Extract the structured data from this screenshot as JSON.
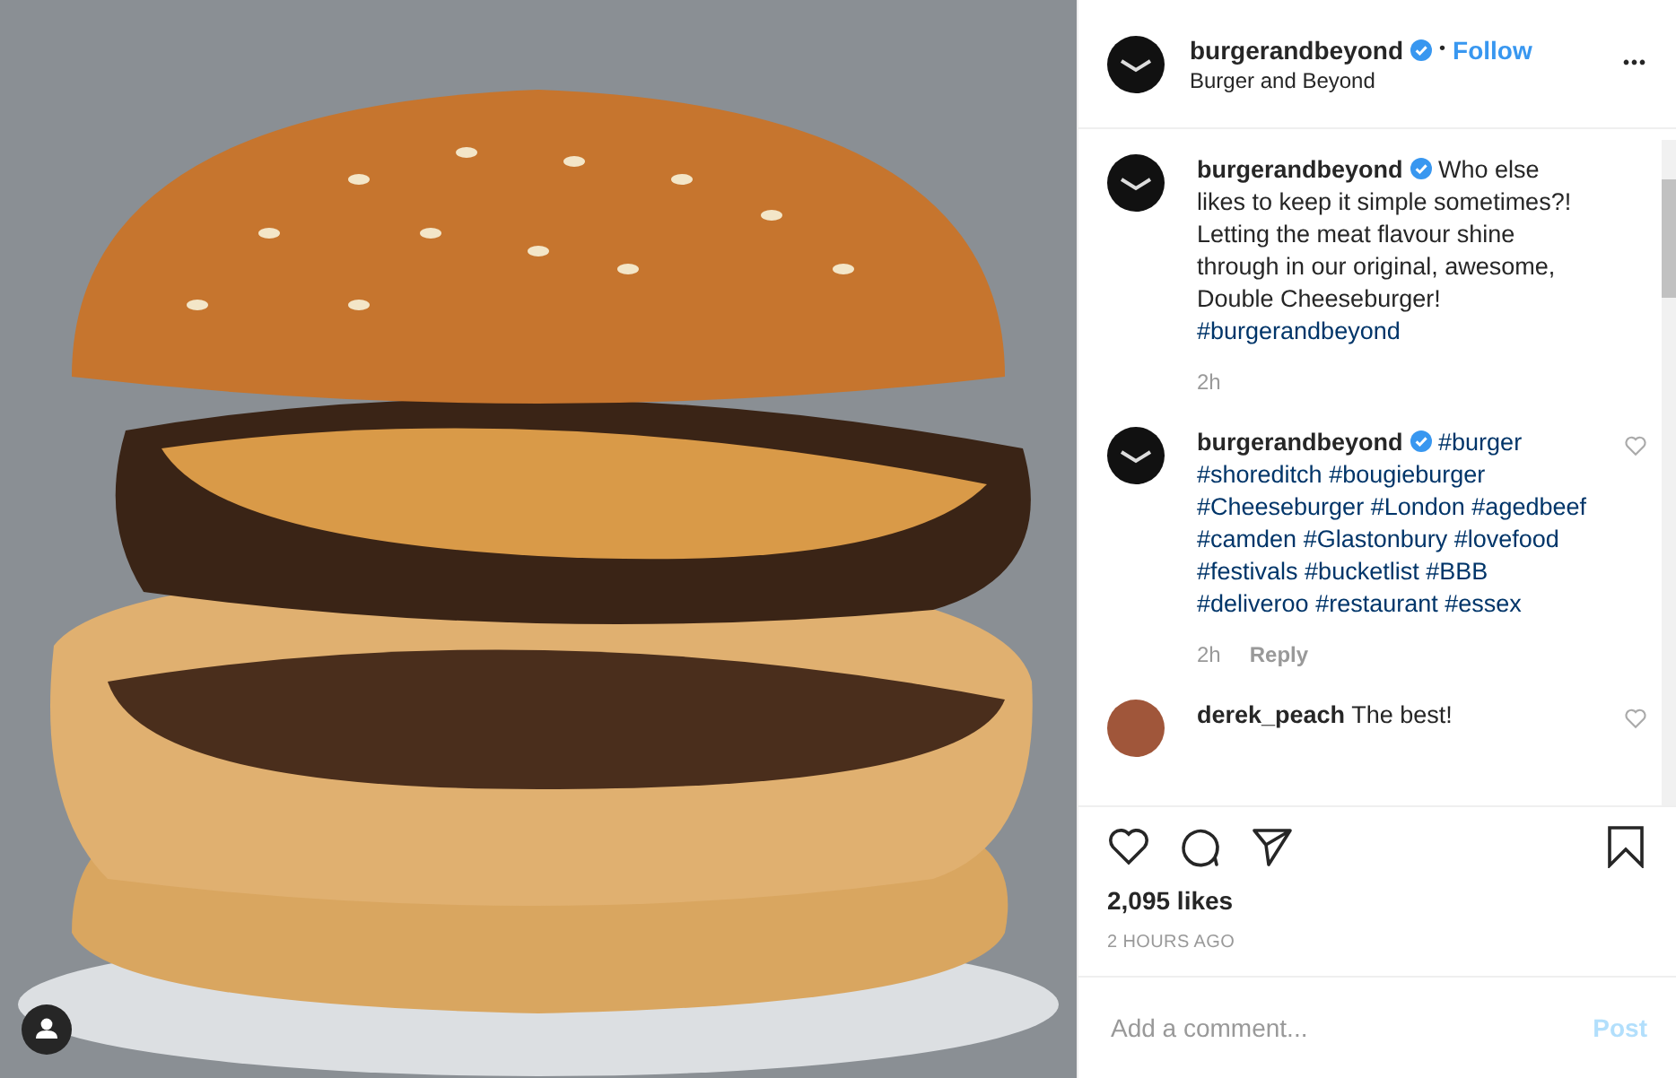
{
  "header": {
    "username": "burgerandbeyond",
    "verified": true,
    "follow": "Follow",
    "separator": "•",
    "subtitle": "Burger and Beyond",
    "menu": "•••"
  },
  "comments": [
    {
      "kind": "caption",
      "username": "burgerandbeyond",
      "verified": true,
      "parts": [
        {
          "kind": "text",
          "text": "Who else likes to keep it simple sometimes?! Letting the meat flavour shine through in our original, awesome, Double Cheeseburger!"
        },
        {
          "kind": "break"
        },
        {
          "kind": "tag",
          "text": "#burgerandbeyond"
        }
      ],
      "time": "2h"
    },
    {
      "kind": "reply",
      "username": "burgerandbeyond",
      "verified": true,
      "parts": [
        {
          "kind": "tag",
          "text": "#burger"
        },
        {
          "kind": "tag",
          "text": "#shoreditch"
        },
        {
          "kind": "tag",
          "text": "#bougieburger"
        },
        {
          "kind": "tag",
          "text": "#Cheeseburger"
        },
        {
          "kind": "tag",
          "text": "#London"
        },
        {
          "kind": "tag",
          "text": "#agedbeef"
        },
        {
          "kind": "tag",
          "text": "#camden"
        },
        {
          "kind": "tag",
          "text": "#Glastonbury"
        },
        {
          "kind": "tag",
          "text": "#lovefood"
        },
        {
          "kind": "tag",
          "text": "#festivals"
        },
        {
          "kind": "tag",
          "text": "#bucketlist"
        },
        {
          "kind": "tag",
          "text": "#BBB"
        },
        {
          "kind": "tag",
          "text": "#deliveroo"
        },
        {
          "kind": "tag",
          "text": "#restaurant"
        },
        {
          "kind": "tag",
          "text": "#essex"
        }
      ],
      "time": "2h",
      "reply": "Reply"
    },
    {
      "kind": "user",
      "username": "derek_peach",
      "verified": false,
      "parts": [
        {
          "kind": "text",
          "text": "The best!"
        }
      ]
    }
  ],
  "likes": "2,095 likes",
  "time_ago": "2 HOURS AGO",
  "comment_box": {
    "placeholder": "Add a comment...",
    "post": "Post",
    "post_disabled": true
  }
}
